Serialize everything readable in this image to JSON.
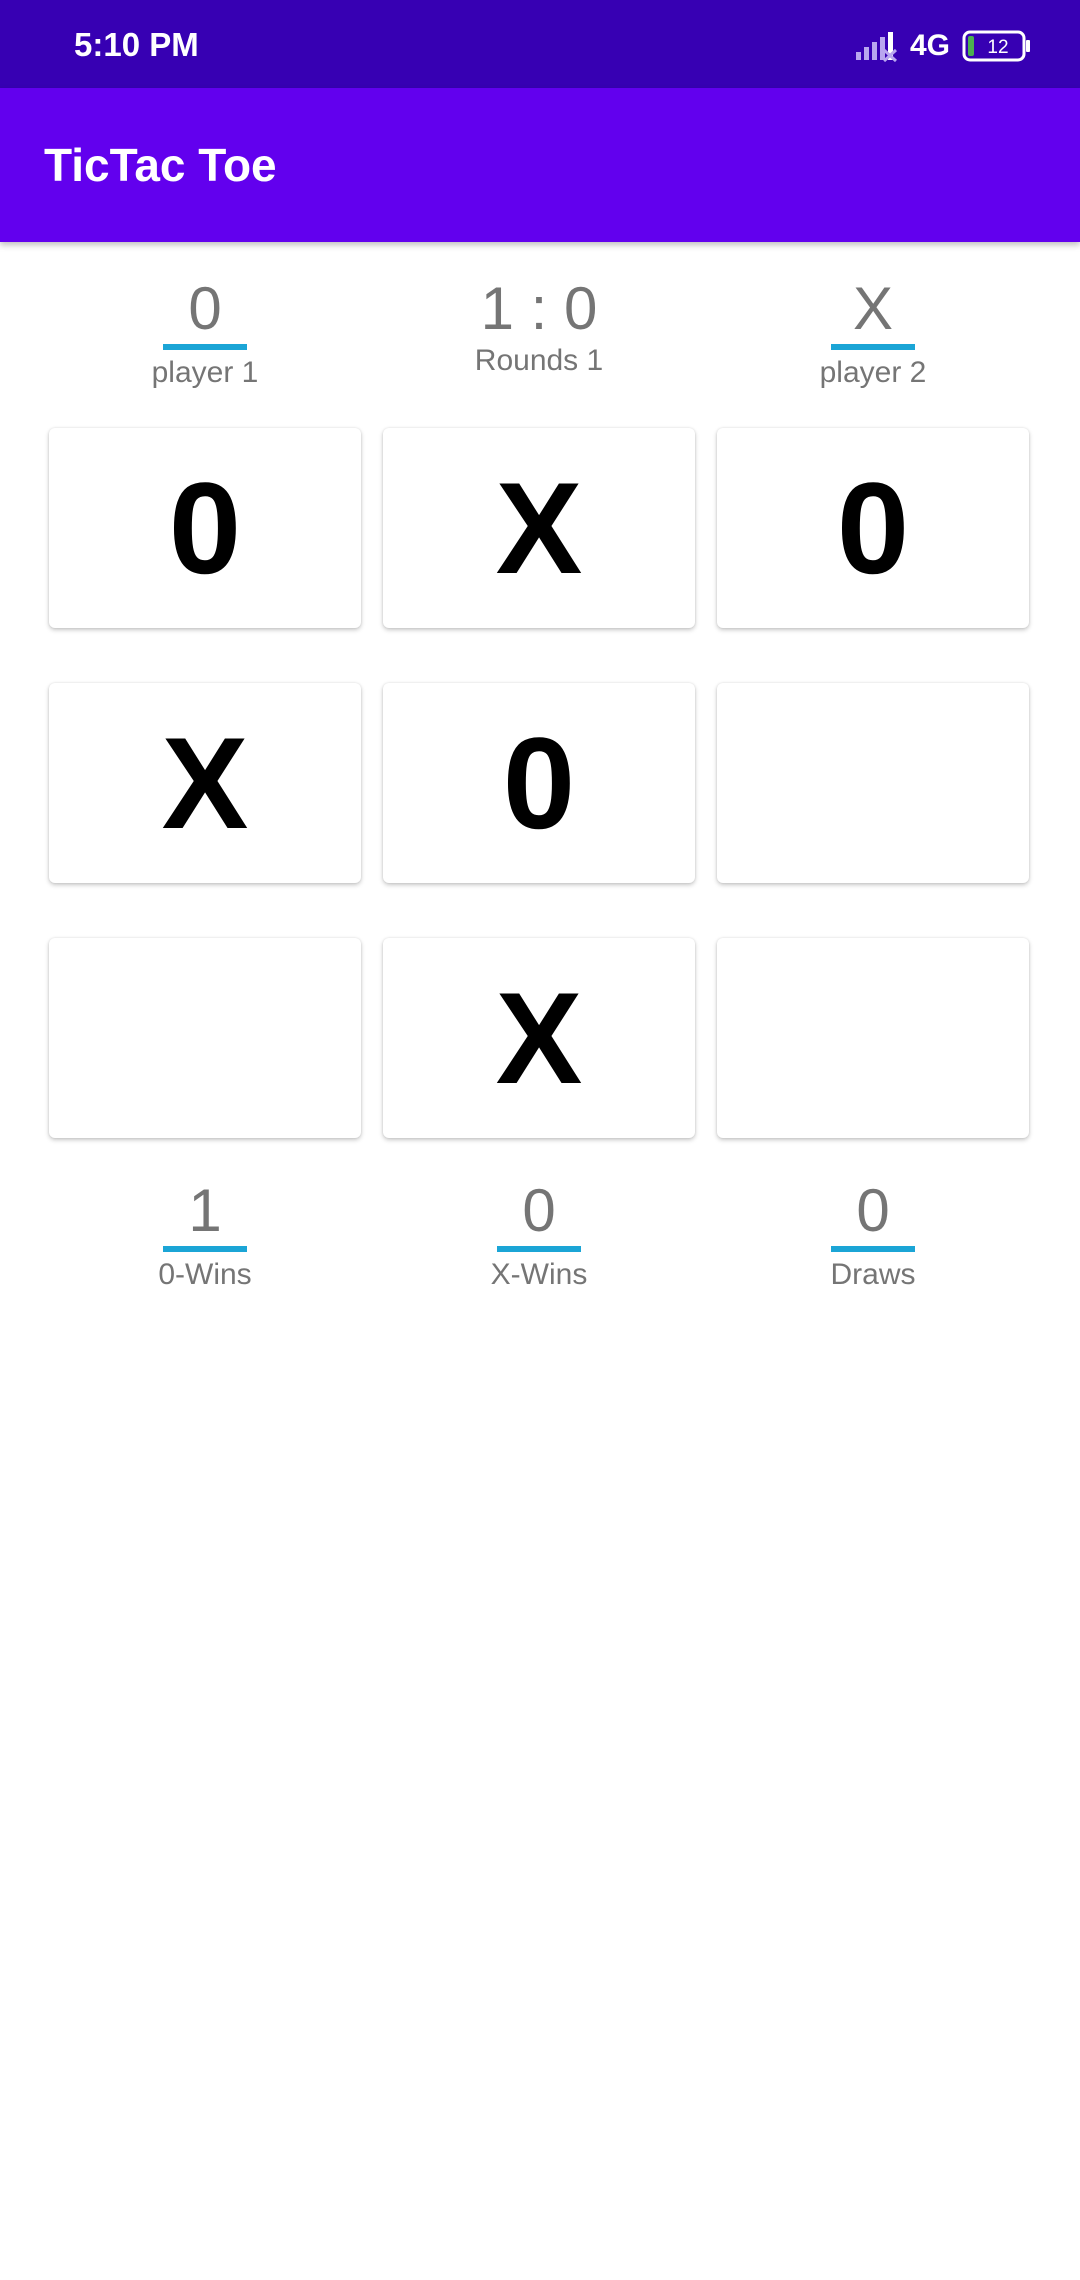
{
  "status_bar": {
    "time": "5:10 PM",
    "network": "4G",
    "battery": "12",
    "icons": [
      "signal-icon",
      "battery-icon"
    ]
  },
  "app_bar": {
    "title": "TicTac Toe",
    "color": "#6200ee",
    "status_color": "#3700b3"
  },
  "header": {
    "player1": {
      "value": "0",
      "label": "player 1"
    },
    "score": {
      "value": "1 : 0",
      "label": "Rounds 1"
    },
    "player2": {
      "value": "X",
      "label": "player 2"
    }
  },
  "board": {
    "cells": [
      "0",
      "X",
      "0",
      "X",
      "0",
      "",
      "",
      "X",
      ""
    ]
  },
  "stats": {
    "o_wins": {
      "value": "1",
      "label": "0-Wins"
    },
    "x_wins": {
      "value": "0",
      "label": "X-Wins"
    },
    "draws": {
      "value": "0",
      "label": "Draws"
    }
  },
  "accent_color": "#1ba5d6"
}
